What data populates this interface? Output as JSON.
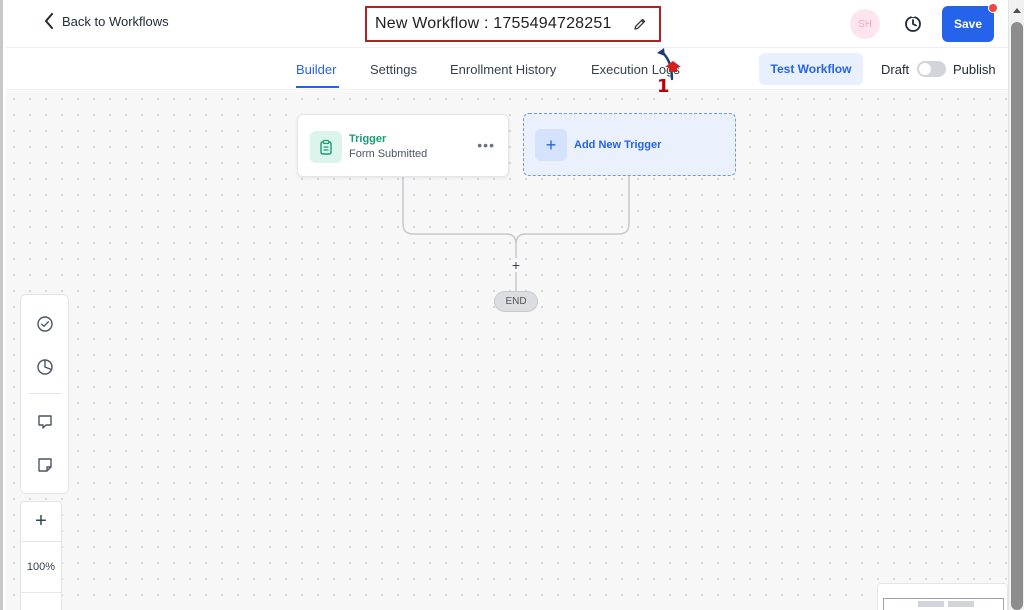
{
  "header": {
    "back_label": "Back to Workflows",
    "workflow_title": "New Workflow : 1755494728251",
    "avatar_initials": "SH",
    "save_label": "Save"
  },
  "tabs": [
    {
      "label": "Builder",
      "active": true
    },
    {
      "label": "Settings",
      "active": false
    },
    {
      "label": "Enrollment History",
      "active": false
    },
    {
      "label": "Execution Logs",
      "active": false
    }
  ],
  "actions": {
    "test_label": "Test Workflow",
    "draft_label": "Draft",
    "publish_label": "Publish",
    "publish_toggle_on": false
  },
  "annotation": {
    "number": "1"
  },
  "builder": {
    "trigger": {
      "title": "Trigger",
      "subtitle": "Form Submitted",
      "menu": "•••"
    },
    "add_trigger_label": "Add New Trigger",
    "add_icon": "+",
    "plus_node": "+",
    "end_label": "END"
  },
  "zoom": {
    "plus": "+",
    "level": "100%"
  },
  "icons": [
    "chevron-left-icon",
    "pencil-icon",
    "history-icon",
    "clipboard-icon",
    "check-circle-icon",
    "pie-chart-icon",
    "comment-icon",
    "sticky-note-icon"
  ],
  "colors": {
    "accent": "#2563eb",
    "trigger_green": "#1a9c76",
    "annotation_red": "#c00000"
  }
}
